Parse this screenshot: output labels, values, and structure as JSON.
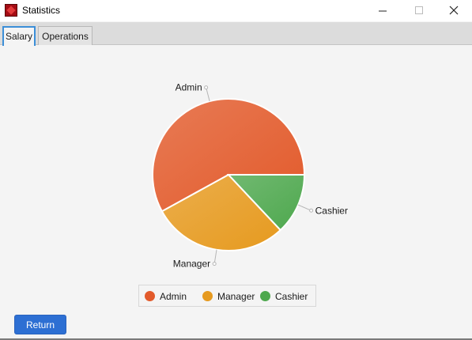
{
  "window": {
    "title": "Statistics"
  },
  "tabs": [
    {
      "label": "Salary",
      "active": true
    },
    {
      "label": "Operations",
      "active": false
    }
  ],
  "chart_data": {
    "type": "pie",
    "labels": [
      "Admin",
      "Manager",
      "Cashier"
    ],
    "values": [
      58,
      29,
      13
    ],
    "colors": [
      "#e25a2b",
      "#e69a1f",
      "#4ea84e"
    ],
    "legend": [
      "Admin",
      "Manager",
      "Cashier"
    ],
    "legend_position": "bottom"
  },
  "actions": {
    "return_label": "Return"
  }
}
